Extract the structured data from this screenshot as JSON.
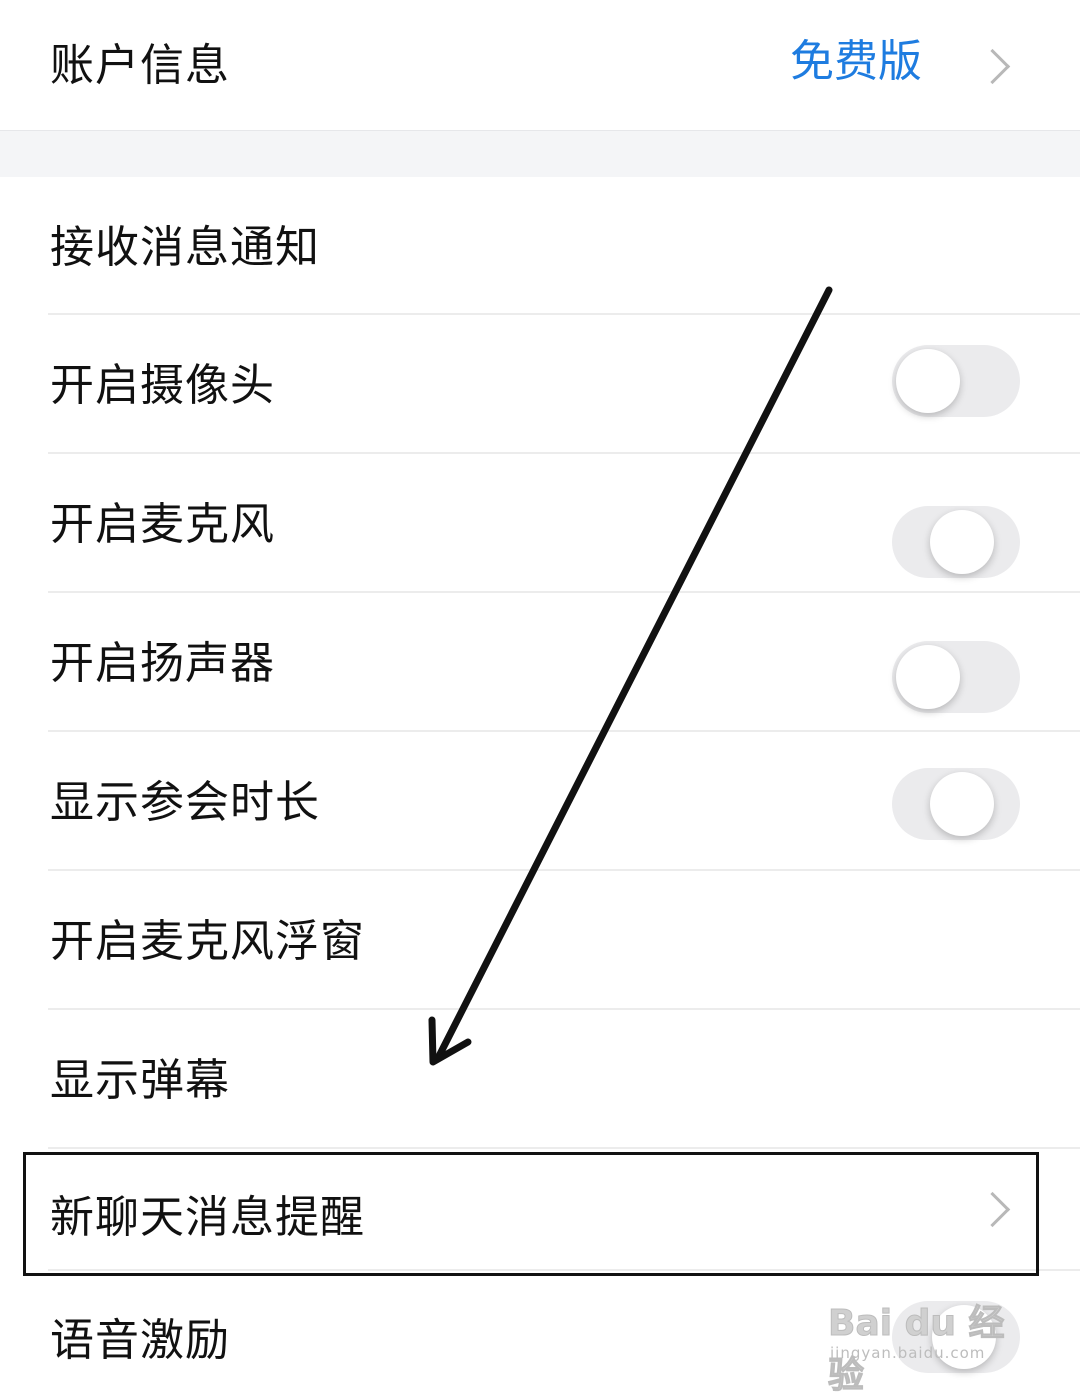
{
  "account": {
    "label": "账户信息",
    "value": "免费版"
  },
  "settings": [
    {
      "label": "接收消息通知"
    },
    {
      "label": "开启摄像头",
      "toggle": "off"
    },
    {
      "label": "开启麦克风",
      "toggle": "off"
    },
    {
      "label": "开启扬声器",
      "toggle": "off"
    },
    {
      "label": "显示参会时长",
      "toggle": "off"
    },
    {
      "label": "开启麦克风浮窗"
    },
    {
      "label": "显示弹幕"
    },
    {
      "label": "新聊天消息提醒",
      "highlighted": true
    },
    {
      "label": "语音激励",
      "toggle": "off"
    }
  ],
  "colors": {
    "accent": "#1e7ce0",
    "toggle_off_track": "#ebebed",
    "section_gap": "#f4f5f7"
  },
  "watermark": {
    "main": "Bai du 经验",
    "sub": "jingyan.baidu.com"
  }
}
